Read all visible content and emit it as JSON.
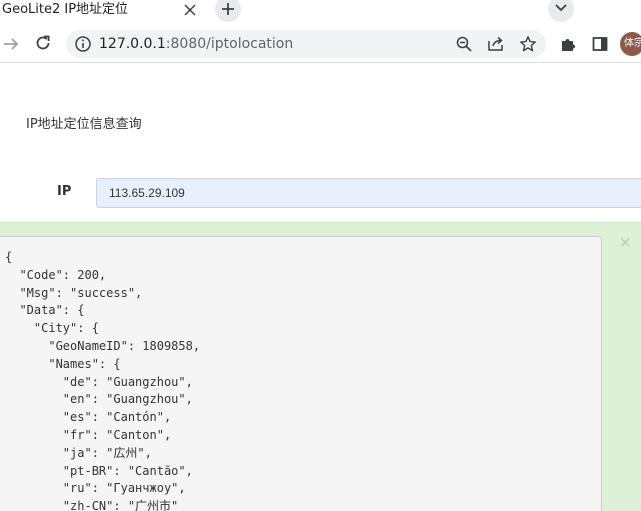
{
  "browser": {
    "tab": {
      "title": "GeoLite2 IP地址定位"
    },
    "address_bar": {
      "host": "127.0.0.1",
      "rest": ":8080/iptolocation"
    },
    "profile": {
      "avatar_text": "体宗"
    }
  },
  "icons": {
    "close": "close-icon",
    "new_tab": "plus-icon",
    "tab_search": "chevron-down-icon",
    "forward": "arrow-right-icon",
    "reload": "reload-icon",
    "site_info": "info-icon",
    "zoom": "zoom-out-icon",
    "share": "share-icon",
    "bookmark": "star-icon",
    "extensions": "puzzle-icon",
    "side_panel": "side-panel-icon"
  },
  "page": {
    "title": "IP地址定位信息查询",
    "ip_label": "IP",
    "ip_value": "113.65.29.109",
    "result": {
      "close_glyph": "×",
      "json_text": "{\n  \"Code\": 200,\n  \"Msg\": \"success\",\n  \"Data\": {\n    \"City\": {\n      \"GeoNameID\": 1809858,\n      \"Names\": {\n        \"de\": \"Guangzhou\",\n        \"en\": \"Guangzhou\",\n        \"es\": \"Cantón\",\n        \"fr\": \"Canton\",\n        \"ja\": \"広州\",\n        \"pt-BR\": \"Cantão\",\n        \"ru\": \"Гуанчжоу\",\n        \"zh-CN\": \"广州市\""
    }
  },
  "colors": {
    "alert_background": "#dff0d8",
    "input_autofill": "#e8f0fe",
    "code_background": "#f5f5f5"
  }
}
